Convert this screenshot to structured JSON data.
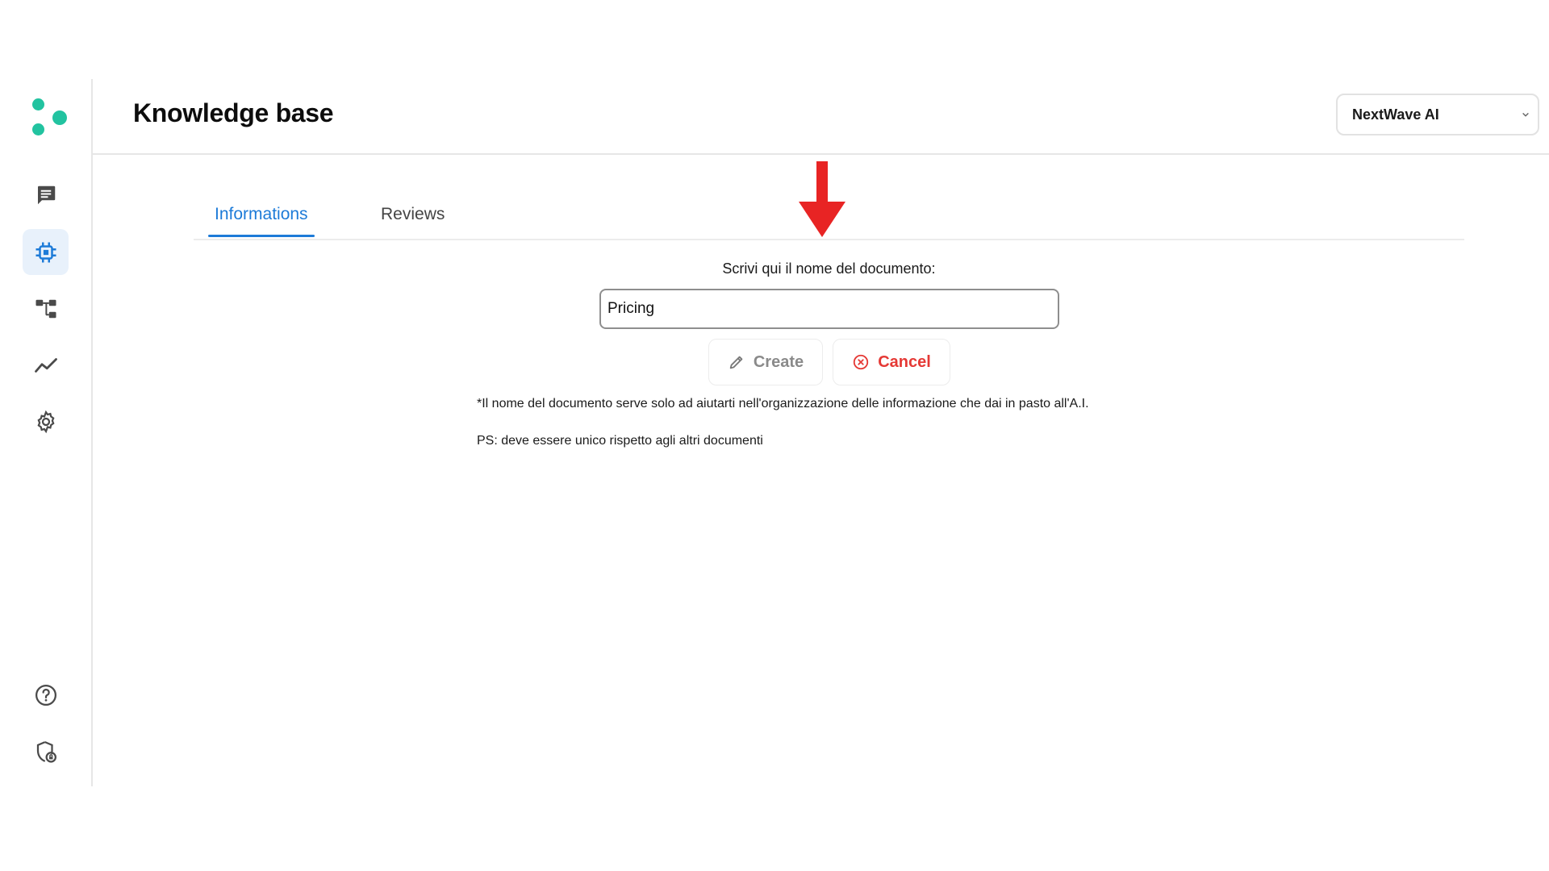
{
  "header": {
    "title": "Knowledge base",
    "workspace_selected": "NextWave AI"
  },
  "sidebar": {
    "items": [
      {
        "name": "chat-icon"
      },
      {
        "name": "chip-icon",
        "active": true
      },
      {
        "name": "workflow-icon"
      },
      {
        "name": "analytics-icon"
      },
      {
        "name": "gear-icon"
      }
    ],
    "bottom": [
      {
        "name": "help-icon"
      },
      {
        "name": "shield-lock-icon"
      }
    ]
  },
  "tabs": {
    "informations": "Informations",
    "reviews": "Reviews",
    "active": "Informations"
  },
  "form": {
    "label": "Scrivi qui il nome del documento:",
    "input_value": "Pricing",
    "create_label": "Create",
    "cancel_label": "Cancel"
  },
  "notes": {
    "note_1": "*Il nome del documento serve solo ad aiutarti nell'organizzazione delle informazione che dai in pasto all'A.I.",
    "note_2": "PS: deve essere unico rispetto agli altri documenti"
  },
  "colors": {
    "accent": "#1d7bd8",
    "brand": "#22c3a0",
    "danger": "#e53935",
    "annotation_arrow": "#e82424"
  }
}
